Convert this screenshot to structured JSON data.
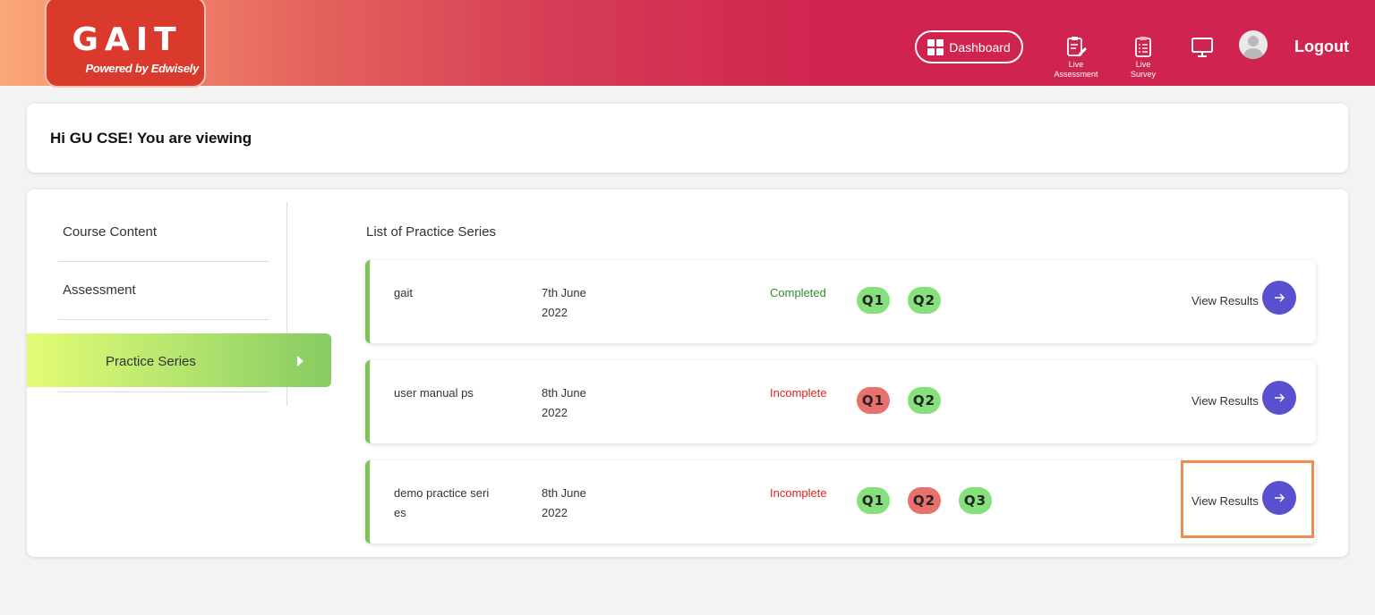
{
  "header": {
    "logo_title": "GAIT",
    "logo_sub": "Powered by Edwisely",
    "dashboard_label": "Dashboard",
    "live_assessment_line1": "Live",
    "live_assessment_line2": "Assessment",
    "live_survey_line1": "Live",
    "live_survey_line2": "Survey",
    "logout_label": "Logout"
  },
  "greeting": "Hi GU CSE! You are viewing",
  "sidebar": {
    "items": [
      {
        "label": "Course Content"
      },
      {
        "label": "Assessment"
      },
      {
        "label": "Practice Series",
        "active": true
      }
    ]
  },
  "list_title": "List of Practice Series",
  "colors": {
    "complete": "#2e8b2e",
    "incomplete": "#e02424",
    "q_pass": "#86e07b",
    "q_fail": "#e8706d",
    "accent": "#5a4fcf",
    "highlight": "#f4894f"
  },
  "series": [
    {
      "name": "gait",
      "date_line1": "7th June",
      "date_line2": "2022",
      "status": "Completed",
      "quizzes": [
        {
          "label": "Q1",
          "state": "pass"
        },
        {
          "label": "Q2",
          "state": "pass"
        }
      ],
      "view_label": "View Results"
    },
    {
      "name": "user manual ps",
      "date_line1": "8th June",
      "date_line2": "2022",
      "status": "Incomplete",
      "quizzes": [
        {
          "label": "Q1",
          "state": "fail"
        },
        {
          "label": "Q2",
          "state": "pass"
        }
      ],
      "view_label": "View Results"
    },
    {
      "name": "demo practice series",
      "date_line1": "8th June",
      "date_line2": "2022",
      "status": "Incomplete",
      "quizzes": [
        {
          "label": "Q1",
          "state": "pass"
        },
        {
          "label": "Q2",
          "state": "fail"
        },
        {
          "label": "Q3",
          "state": "pass"
        }
      ],
      "view_label": "View Results"
    }
  ]
}
